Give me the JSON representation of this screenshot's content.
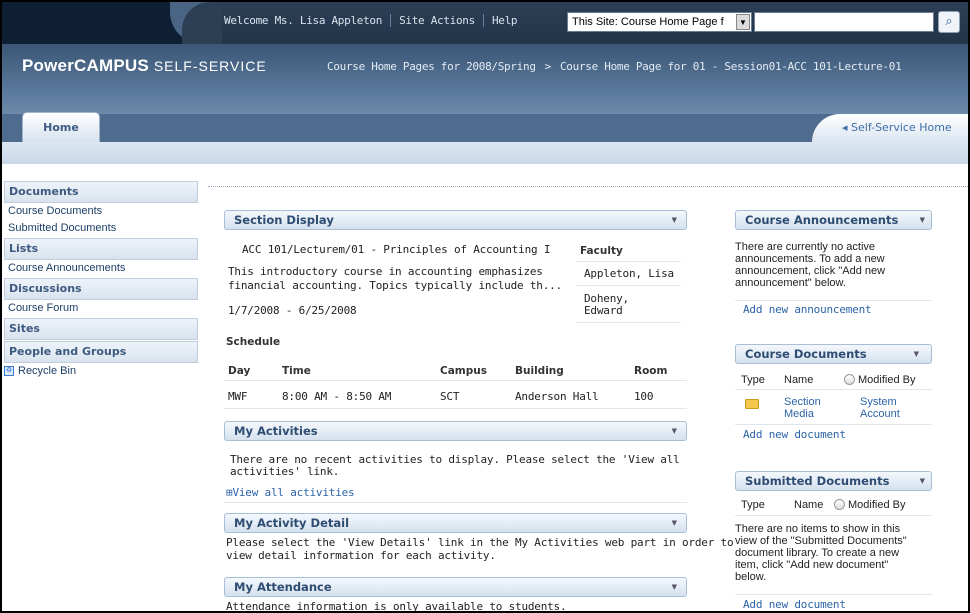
{
  "header": {
    "welcome": "Welcome Ms. Lisa Appleton",
    "site_actions": "Site Actions",
    "help": "Help",
    "scope": "This Site: Course Home Page f",
    "search_value": "",
    "logo_main": "PowerCAMPUS",
    "logo_sub": "SELF-SERVICE",
    "breadcrumb": [
      "Course Home Pages for 2008/Spring",
      "Course Home Page for 01 - Session01-ACC 101-Lecture-01"
    ],
    "breadcrumb_sep": ">",
    "home_tab": "Home",
    "self_service_home": "◂ Self-Service Home"
  },
  "sidebar": {
    "documents": "Documents",
    "course_documents": "Course Documents",
    "submitted_documents": "Submitted Documents",
    "lists": "Lists",
    "course_announcements": "Course Announcements",
    "discussions": "Discussions",
    "course_forum": "Course Forum",
    "sites": "Sites",
    "people_groups": "People and Groups",
    "recycle_bin": "Recycle Bin"
  },
  "section_display": {
    "title": "Section Display",
    "course": "ACC 101/Lecturem/01 - Principles of Accounting I",
    "desc1": "This introductory course in accounting emphasizes",
    "desc2": "financial accounting. Topics typically include th...",
    "dates": "1/7/2008 - 6/25/2008",
    "faculty_label": "Faculty",
    "faculty": [
      "Appleton, Lisa",
      "Doheny,",
      "Edward"
    ],
    "schedule_label": "Schedule",
    "columns": [
      "Day",
      "Time",
      "Campus",
      "Building",
      "Room"
    ],
    "row": [
      "MWF",
      "8:00 AM - 8:50 AM",
      "SCT",
      "Anderson Hall",
      "100"
    ]
  },
  "activities": {
    "title": "My Activities",
    "msg1": "There are no recent activities to display. Please select the 'View all",
    "msg2": "activities' link.",
    "view_all": "View all activities"
  },
  "activity_detail": {
    "title": "My Activity Detail",
    "msg1": "Please select the 'View Details' link in the My Activities web part in order to",
    "msg2": "view detail information for each activity."
  },
  "attendance": {
    "title": "My Attendance",
    "msg": "Attendance information is only available to students."
  },
  "announcements": {
    "title": "Course Announcements",
    "msg": [
      "There are currently no active",
      "announcements. To add a new",
      "announcement, click \"Add new",
      "announcement\" below."
    ],
    "add": "Add new announcement"
  },
  "course_docs": {
    "title": "Course Documents",
    "cols": [
      "Type",
      "Name",
      "Modified By"
    ],
    "item_name": [
      "Section",
      "Media"
    ],
    "item_by": [
      "System",
      "Account"
    ],
    "add": "Add new document"
  },
  "submitted_docs": {
    "title": "Submitted Documents",
    "cols": [
      "Type",
      "Name",
      "Modified By"
    ],
    "msg": [
      "There are no items to show in this",
      "view of the \"Submitted Documents\"",
      "document library. To create a new",
      "item, click \"Add new document\"",
      "below."
    ],
    "add": "Add new document"
  }
}
